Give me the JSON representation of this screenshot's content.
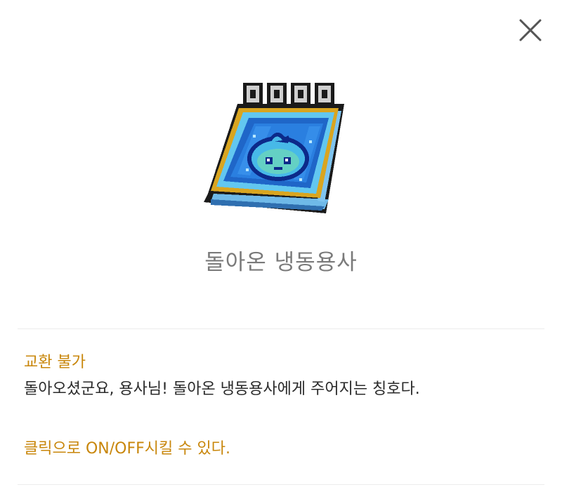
{
  "item": {
    "name": "돌아온 냉동용사",
    "icon": "frozen-hero-title-icon"
  },
  "details": {
    "trade_status": "교환 불가",
    "description": "돌아오셨군요, 용사님! 돌아온 냉동용사에게 주어지는 칭호다.",
    "toggle_hint": "클릭으로 ON/OFF시킬 수 있다."
  },
  "colors": {
    "accent": "#c8860a",
    "title_text": "#7a7a7a",
    "body_text": "#2a2a2a",
    "divider": "#ececec"
  }
}
